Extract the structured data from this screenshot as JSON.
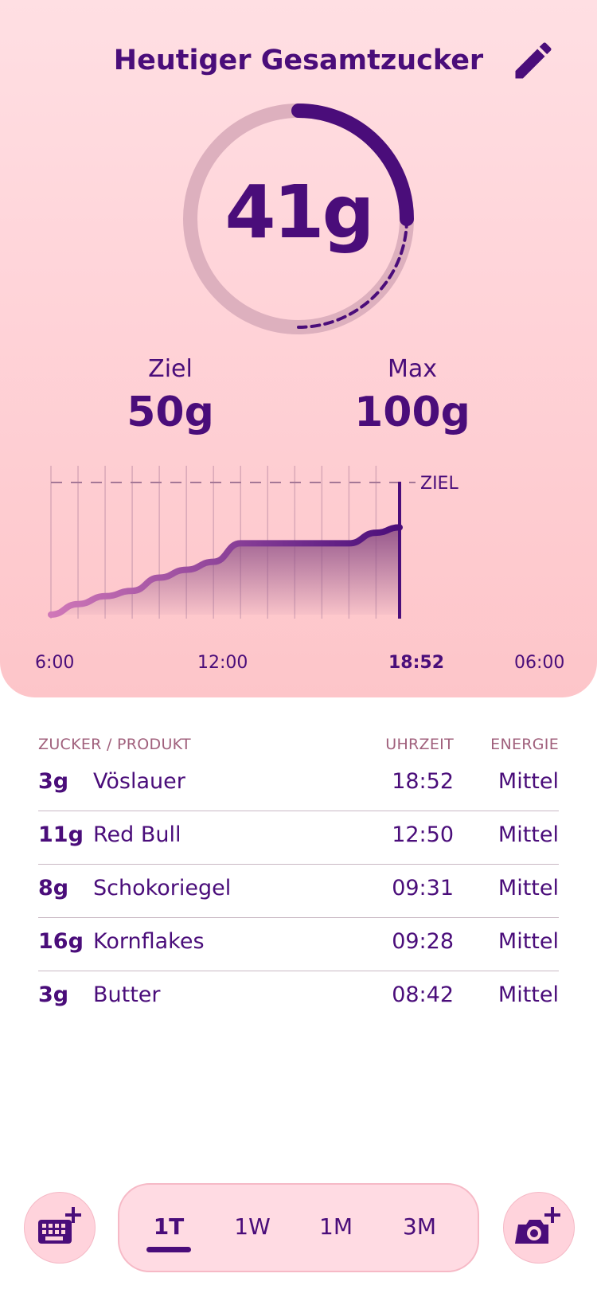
{
  "header": {
    "title": "Heutiger Gesamtzucker"
  },
  "progress": {
    "current_value": "41g",
    "current_grams": 41,
    "target_grams": 50,
    "max_grams": 100,
    "completed_fraction": 0.25,
    "forecast_fraction": 0.25
  },
  "stats": {
    "goal_label": "Ziel",
    "goal_value": "50g",
    "max_label": "Max",
    "max_value": "100g"
  },
  "chart_data": {
    "type": "area",
    "goal_line_label": "ZIEL",
    "x_ticks": [
      "6:00",
      "12:00",
      "18:52",
      "06:00"
    ],
    "x_hours": [
      6,
      7,
      8,
      9,
      10,
      11,
      12,
      13,
      14,
      15,
      16,
      17,
      18,
      18.87
    ],
    "y_grams": [
      0,
      4,
      7,
      9,
      14,
      17,
      20,
      27,
      27,
      27,
      27,
      27,
      31,
      33
    ],
    "goal_grams": 50,
    "now_label": "18:52",
    "colors": {
      "line_start": "#d078b8",
      "line_end": "#4a0d7a",
      "fill": "#8a4a84"
    }
  },
  "log": {
    "headers": {
      "sugar_product": "ZUCKER / PRODUKT",
      "time": "UHRZEIT",
      "energy": "ENERGIE"
    },
    "rows": [
      {
        "sugar": "3g",
        "product": "Vöslauer",
        "time": "18:52",
        "energy": "Mittel"
      },
      {
        "sugar": "11g",
        "product": "Red Bull",
        "time": "12:50",
        "energy": "Mittel"
      },
      {
        "sugar": "8g",
        "product": "Schokoriegel",
        "time": "09:31",
        "energy": "Mittel"
      },
      {
        "sugar": "16g",
        "product": "Kornflakes",
        "time": "09:28",
        "energy": "Mittel"
      },
      {
        "sugar": "3g",
        "product": "Butter",
        "time": "08:42",
        "energy": "Mittel"
      }
    ]
  },
  "range_tabs": [
    {
      "label": "1T",
      "active": true
    },
    {
      "label": "1W",
      "active": false
    },
    {
      "label": "1M",
      "active": false
    },
    {
      "label": "3M",
      "active": false
    }
  ],
  "icons": {
    "edit": "pencil-icon",
    "keyboard_add": "keyboard-add-icon",
    "camera_add": "camera-add-icon"
  },
  "colors": {
    "accent": "#4a0d7a",
    "ring_track": "#ddb0be",
    "header_bg": "#ffd6da"
  }
}
